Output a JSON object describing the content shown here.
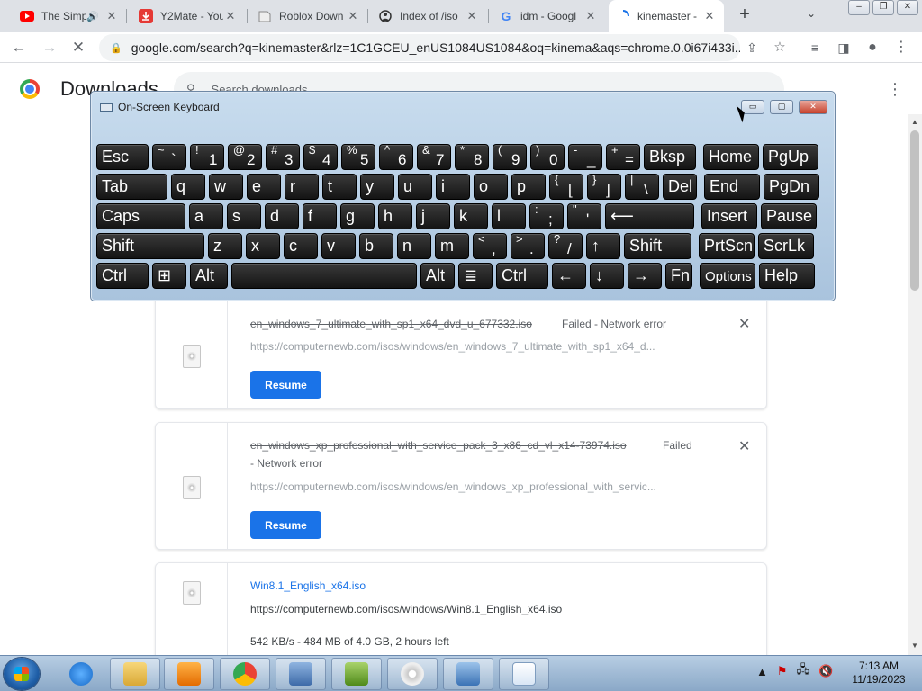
{
  "tabs": [
    {
      "title": "The Simp",
      "icon": "youtube-icon",
      "audible": true
    },
    {
      "title": "Y2Mate - You",
      "icon": "y2mate-download-icon"
    },
    {
      "title": "Roblox Down",
      "icon": "roblox-page-icon"
    },
    {
      "title": "Index of /iso",
      "icon": "index-page-icon"
    },
    {
      "title": "idm - Googl",
      "icon": "google-icon"
    },
    {
      "title": "kinemaster -",
      "icon": "loading-spinner-icon",
      "active": true
    }
  ],
  "toolbar": {
    "url": "google.com/search?q=kinemaster&rlz=1C1GCEU_enUS1084US1084&oq=kinema&aqs=chrome.0.0i67i433i..."
  },
  "downloads": {
    "title": "Downloads",
    "search_placeholder": "Search downloads",
    "items": [
      {
        "name": "en_windows_7_ultimate_with_sp1_x64_dvd_u_677332.iso",
        "status": "Failed - Network error",
        "url": "https://computernewb.com/isos/windows/en_windows_7_ultimate_with_sp1_x64_d...",
        "action": "Resume"
      },
      {
        "name": "en_windows_xp_professional_with_service_pack_3_x86_cd_vl_x14-73974.iso",
        "status_a": "Failed",
        "status_b": "- Network error",
        "url": "https://computernewb.com/isos/windows/en_windows_xp_professional_with_servic...",
        "action": "Resume"
      },
      {
        "name": "Win8.1_English_x64.iso",
        "url": "https://computernewb.com/isos/windows/Win8.1_English_x64.iso",
        "progress": "542 KB/s - 484 MB of 4.0 GB, 2 hours left"
      }
    ]
  },
  "osk": {
    "title": "On-Screen Keyboard",
    "rows": [
      [
        [
          "Esc",
          ""
        ],
        [
          "~",
          "`"
        ],
        [
          "!",
          "1"
        ],
        [
          "@",
          "2"
        ],
        [
          "#",
          "3"
        ],
        [
          "$",
          "4"
        ],
        [
          "%",
          "5"
        ],
        [
          "^",
          "6"
        ],
        [
          "&",
          "7"
        ],
        [
          "*",
          "8"
        ],
        [
          "(",
          "9"
        ],
        [
          ")",
          "0"
        ],
        [
          "-",
          "_"
        ],
        [
          "+",
          "="
        ],
        [
          "Bksp",
          ""
        ],
        [
          "Home",
          ""
        ],
        [
          "PgUp",
          ""
        ]
      ],
      [
        [
          "Tab",
          ""
        ],
        [
          "q",
          ""
        ],
        [
          "w",
          ""
        ],
        [
          "e",
          ""
        ],
        [
          "r",
          ""
        ],
        [
          "t",
          ""
        ],
        [
          "y",
          ""
        ],
        [
          "u",
          ""
        ],
        [
          "i",
          ""
        ],
        [
          "o",
          ""
        ],
        [
          "p",
          ""
        ],
        [
          "{",
          "["
        ],
        [
          "}",
          "]"
        ],
        [
          "|",
          "\\"
        ],
        [
          "Del",
          ""
        ],
        [
          "End",
          ""
        ],
        [
          "PgDn",
          ""
        ]
      ],
      [
        [
          "Caps",
          ""
        ],
        [
          "a",
          ""
        ],
        [
          "s",
          ""
        ],
        [
          "d",
          ""
        ],
        [
          "f",
          ""
        ],
        [
          "g",
          ""
        ],
        [
          "h",
          ""
        ],
        [
          "j",
          ""
        ],
        [
          "k",
          ""
        ],
        [
          "l",
          ""
        ],
        [
          ":",
          ";"
        ],
        [
          "\"",
          "'"
        ],
        [
          "⟵",
          ""
        ],
        [
          "Insert",
          ""
        ],
        [
          "Pause",
          ""
        ]
      ],
      [
        [
          "Shift",
          ""
        ],
        [
          "z",
          ""
        ],
        [
          "x",
          ""
        ],
        [
          "c",
          ""
        ],
        [
          "v",
          ""
        ],
        [
          "b",
          ""
        ],
        [
          "n",
          ""
        ],
        [
          "m",
          ""
        ],
        [
          "<",
          ","
        ],
        [
          ">",
          "."
        ],
        [
          "?",
          "/"
        ],
        [
          "↑",
          ""
        ],
        [
          "Shift",
          ""
        ],
        [
          "PrtScn",
          ""
        ],
        [
          "ScrLk",
          ""
        ]
      ],
      [
        [
          "Ctrl",
          ""
        ],
        [
          "⊞",
          ""
        ],
        [
          "Alt",
          ""
        ],
        [
          "",
          ""
        ],
        [
          "Alt",
          ""
        ],
        [
          "≣",
          ""
        ],
        [
          "Ctrl",
          ""
        ],
        [
          "←",
          ""
        ],
        [
          "↓",
          ""
        ],
        [
          "→",
          ""
        ],
        [
          "Fn",
          ""
        ],
        [
          "Options",
          ""
        ],
        [
          "Help",
          ""
        ]
      ]
    ]
  },
  "taskbar": {
    "time": "7:13 AM",
    "date": "11/19/2023"
  }
}
